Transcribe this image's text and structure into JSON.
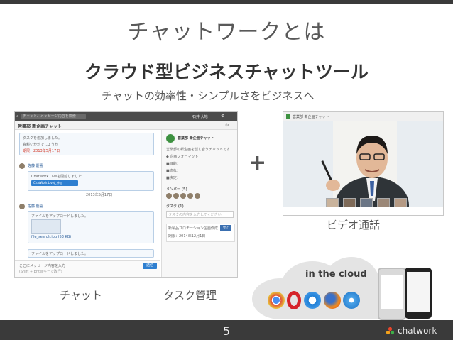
{
  "slide": {
    "title": "チャットワークとは",
    "headline": "クラウド型ビジネスチャットツール",
    "subheadline": "チャットの効率性・シンプルさをビジネスへ",
    "plus": "+",
    "page_number": "5",
    "logo_text": "chatwork"
  },
  "chat_screenshot": {
    "search_placeholder": "チャット、メッセージ内容を検索",
    "user_name": "石井 大地",
    "room_name": "営業部 新企画チャット",
    "messages": [
      {
        "header": "タスクを追加しました。",
        "body": "資料いかがでしょうか",
        "due_label": "期限：2013年5月17日"
      },
      {
        "sender": "佐藤 慶喜",
        "header": "ChatWork Liveを開始しました",
        "button": "ChatWork Liveに参加",
        "time": "2013年5月17日"
      },
      {
        "sender": "佐藤 慶喜",
        "header": "ファイルをアップロードしました。",
        "file": "file_search.jpg (53 KB)"
      },
      {
        "header": "ファイルをアップロードしました。"
      }
    ],
    "composer_placeholder": "ここにメッセージ内容を入力",
    "composer_hint": "(Shift + Enterキーで改行)",
    "send_label": "送信",
    "side_panel": {
      "room_title": "営業部 新企画チャット",
      "desc": "営業部の新企画を話し合うチャットです",
      "items": [
        "◆ 企画フォーマット",
        "■目的：",
        "■流れ：",
        "■決定："
      ],
      "members_label": "メンバー (5)",
      "tasks_label": "タスク (1)",
      "task_input_placeholder": "タスクの内容を入力してください",
      "task_item": "新製品プロモーション企画作成",
      "task_due": "期限：2014年12月1日",
      "task_done": "完了"
    }
  },
  "video_screenshot": {
    "room_name": "営業部 新企画チャット"
  },
  "captions": {
    "chat": "チャット",
    "task": "タスク管理",
    "video": "ビデオ通話",
    "cloud": "in the cloud"
  },
  "colors": {
    "bar": "#3a3a3a",
    "accent_green": "#3d9140",
    "link_blue": "#2e7fd0",
    "due_red": "#d23c2c"
  },
  "icons": [
    "search-icon",
    "gear-icon",
    "chrome-icon",
    "opera-icon",
    "ie-icon",
    "firefox-icon",
    "safari-icon",
    "chatwork-logo-icon"
  ]
}
